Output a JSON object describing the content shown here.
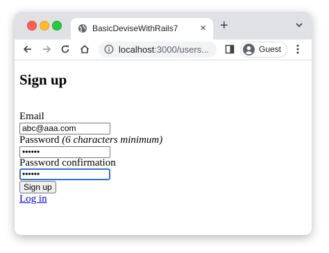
{
  "browser": {
    "tab_title": "BasicDeviseWithRails7",
    "tab_close": "×",
    "new_tab": "+",
    "url_host": "localhost",
    "url_rest": ":3000/users...",
    "profile_name": "Guest"
  },
  "page": {
    "heading": "Sign up",
    "email_label": "Email",
    "email_value": "abc@aaa.com",
    "password_label": "Password",
    "password_hint": "(6 characters minimum)",
    "password_value": "••••••",
    "password_confirmation_label": "Password confirmation",
    "password_confirmation_value": "••••••",
    "submit_label": "Sign up",
    "login_link": "Log in"
  },
  "colors": {
    "titlebar": "#dfe1e5",
    "link": "#0000ee",
    "focus_ring": "#2f6fdb"
  }
}
